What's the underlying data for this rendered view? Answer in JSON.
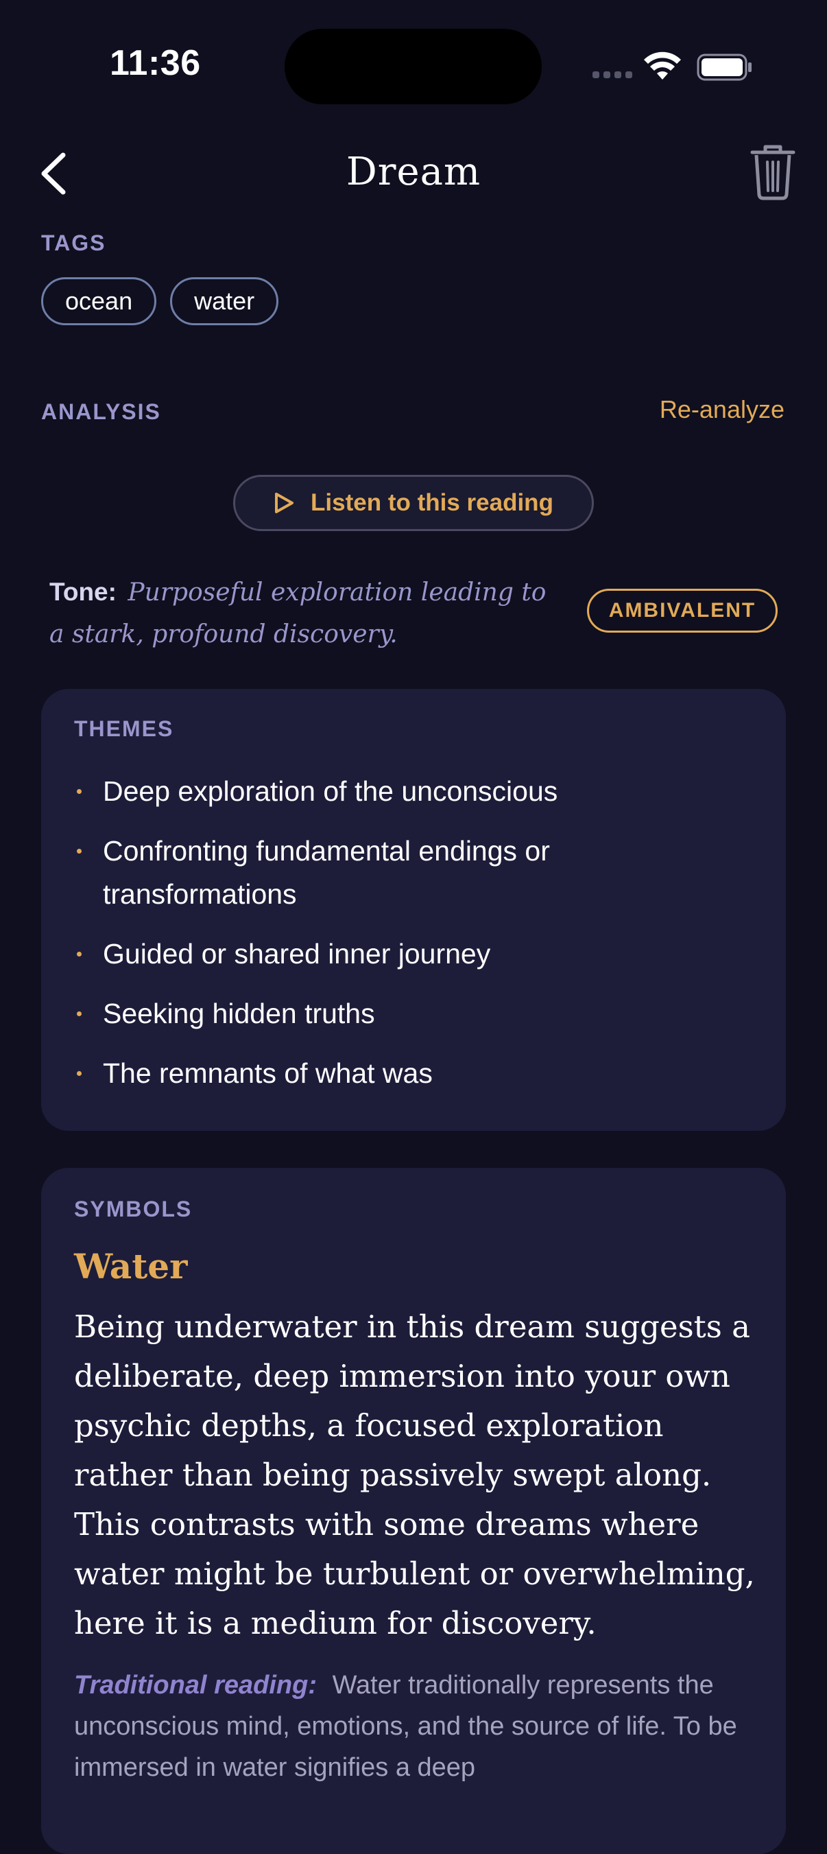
{
  "status": {
    "time": "11:36"
  },
  "nav": {
    "title": "Dream",
    "back_icon": "chevron-left-icon",
    "delete_icon": "trash-icon"
  },
  "tags": {
    "label": "TAGS",
    "items": [
      "ocean",
      "water"
    ]
  },
  "analysis": {
    "label": "ANALYSIS",
    "reanalyze_label": "Re-analyze",
    "listen_label": "Listen to this reading",
    "listen_icon": "play-icon",
    "tone_label": "Tone:",
    "tone_text": "Purposeful exploration leading to a stark, profound discovery.",
    "tone_badge": "AMBIVALENT"
  },
  "themes": {
    "label": "THEMES",
    "items": [
      "Deep exploration of the unconscious",
      "Confronting fundamental endings or transformations",
      "Guided or shared inner journey",
      "Seeking hidden truths",
      "The remnants of what was"
    ]
  },
  "symbols": {
    "label": "SYMBOLS",
    "items": [
      {
        "name": "Water",
        "description": "Being underwater in this dream suggests a deliberate, deep immersion into your own psychic depths, a focused exploration rather than being passively swept along. This contrasts with some dreams where water might be turbulent or overwhelming, here it is a medium for discovery.",
        "traditional_label": "Traditional reading:",
        "traditional_text": "Water traditionally represents the unconscious mind, emotions, and the source of life. To be immersed in water signifies a deep"
      }
    ]
  },
  "colors": {
    "background": "#0f0f1f",
    "card": "#1d1d3a",
    "accent": "#e2aa57",
    "label": "#9a96cc"
  }
}
